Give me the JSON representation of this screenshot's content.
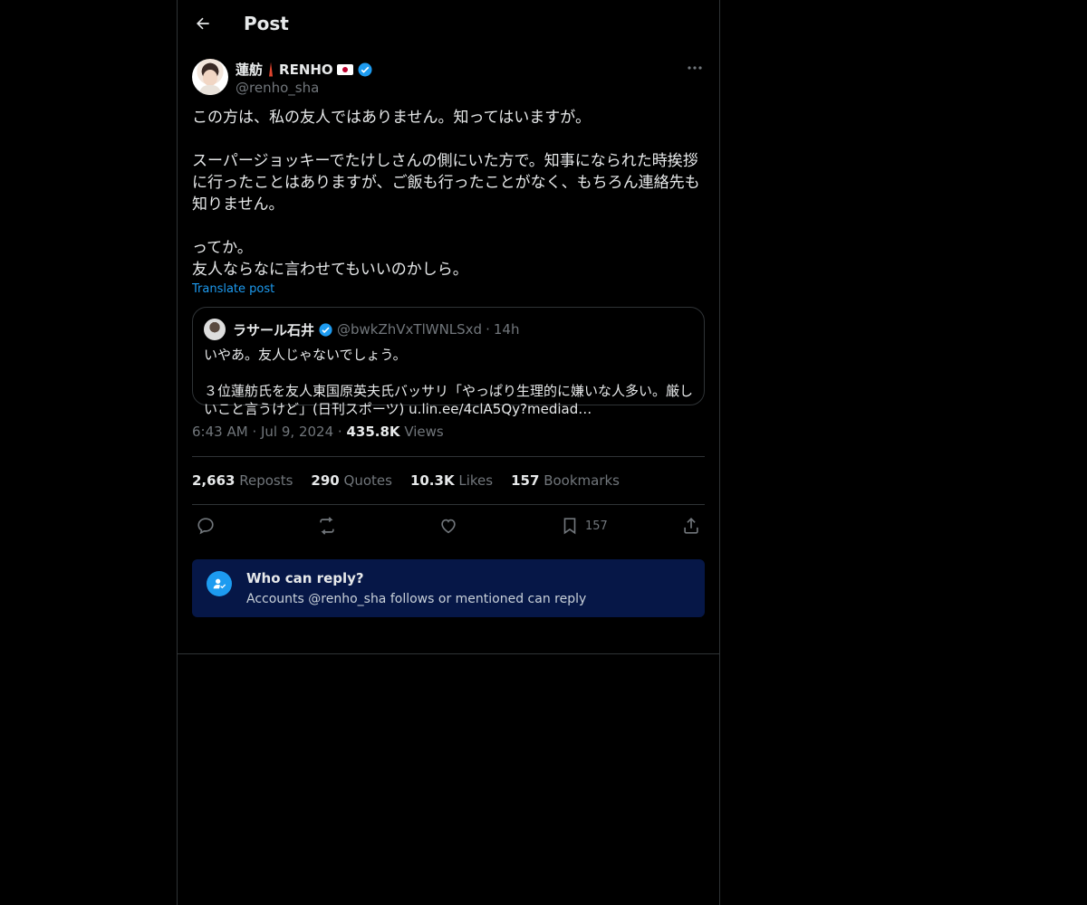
{
  "header": {
    "title": "Post"
  },
  "post": {
    "name_kanji": "蓮舫",
    "name_latin": "RENHO",
    "handle": "@renho_sha",
    "text": "この方は、私の友人ではありません。知ってはいますが。\n\nスーパージョッキーでたけしさんの側にいた方で。知事になられた時挨拶\nに行ったことはありますが、ご飯も行ったことがなく、もちろん連絡先も\n知りません。\n\nってか。\n友人ならなに言わせてもいいのかしら。",
    "translate_label": "Translate post"
  },
  "quote": {
    "name": "ラサール石井",
    "handle": "@bwkZhVxTlWNLSxd",
    "dot": "·",
    "time": "14h",
    "text": "いやあ。友人じゃないでしょう。\n\n３位蓮舫氏を友人東国原英夫氏バッサリ「やっぱり生理的に嫌いな人多い。厳し\nいこと言うけど」(日刊スポーツ) u.lin.ee/4clA5Qy?mediad…"
  },
  "meta": {
    "time": "6:43 AM",
    "sep1": "·",
    "date": "Jul 9, 2024",
    "sep2": "·",
    "views_count": "435.8K",
    "views_label": "Views"
  },
  "stats": {
    "reposts_count": "2,663",
    "reposts_label": "Reposts",
    "quotes_count": "290",
    "quotes_label": "Quotes",
    "likes_count": "10.3K",
    "likes_label": "Likes",
    "bookmarks_count": "157",
    "bookmarks_label": "Bookmarks"
  },
  "actions": {
    "bookmark_count": "157"
  },
  "reply": {
    "title": "Who can reply?",
    "subtitle": "Accounts @renho_sha follows or mentioned can reply"
  },
  "colors": {
    "accent": "#1d9bf0",
    "reply_bg": "#061747",
    "border": "#2f3336"
  },
  "icons": [
    "back-arrow-icon",
    "more-icon",
    "verified-icon",
    "reply-icon",
    "repost-icon",
    "like-icon",
    "bookmark-icon",
    "share-icon",
    "person-check-icon",
    "tokyo-tower-icon",
    "japan-flag-icon"
  ]
}
